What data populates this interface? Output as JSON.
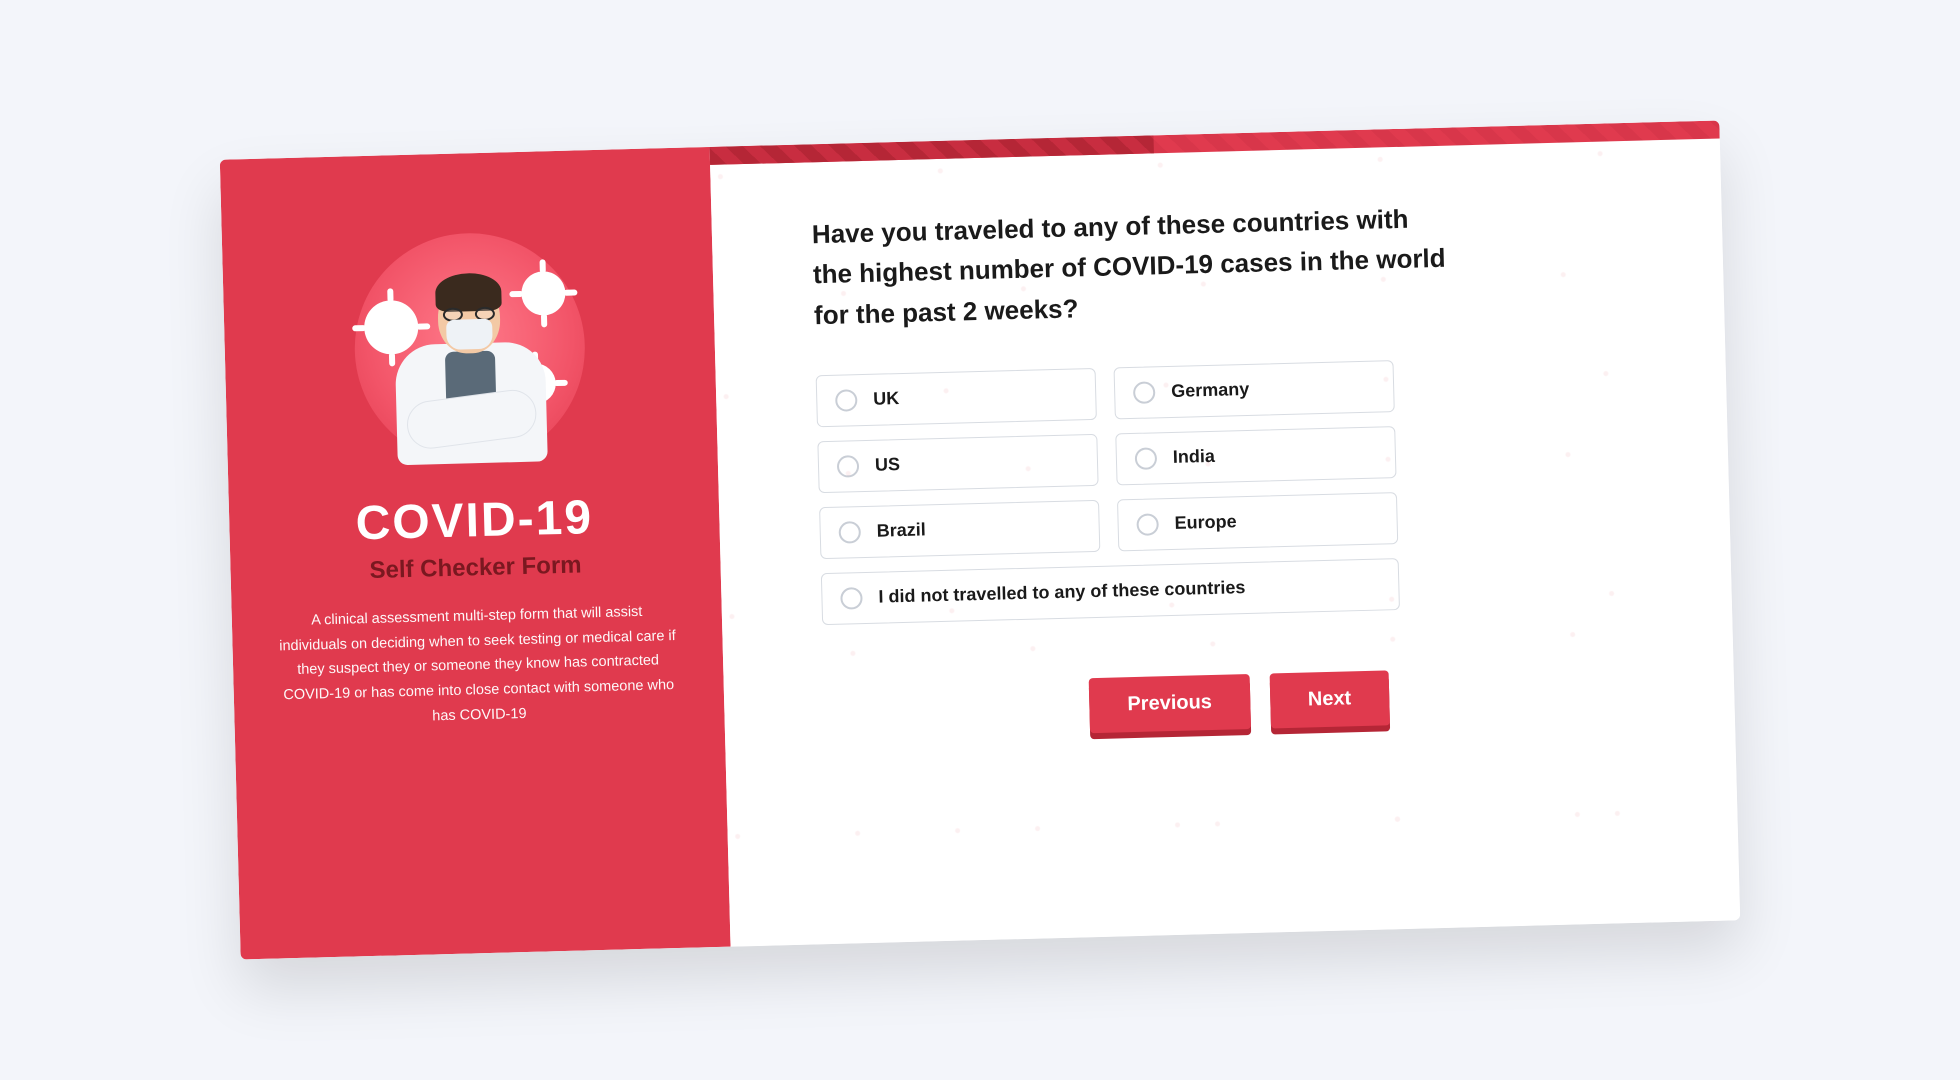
{
  "sidebar": {
    "title": "COVID-19",
    "subtitle": "Self Checker Form",
    "description": "A clinical assessment multi-step form that will assist individuals on deciding when to seek testing or medical care if they suspect they or someone they know has contracted COVID-19 or has come into close contact with someone who has COVID-19"
  },
  "form": {
    "question": "Have you traveled to any of these countries with the highest number of COVID-19 cases in the world for the past 2 weeks?",
    "options": [
      {
        "label": "UK"
      },
      {
        "label": "Germany"
      },
      {
        "label": "US"
      },
      {
        "label": "India"
      },
      {
        "label": "Brazil"
      },
      {
        "label": "Europe"
      }
    ],
    "none_option": "I did not travelled to any of these countries",
    "buttons": {
      "previous": "Previous",
      "next": "Next"
    }
  },
  "colors": {
    "primary": "#e03a4e",
    "primary_dark": "#b52636"
  }
}
